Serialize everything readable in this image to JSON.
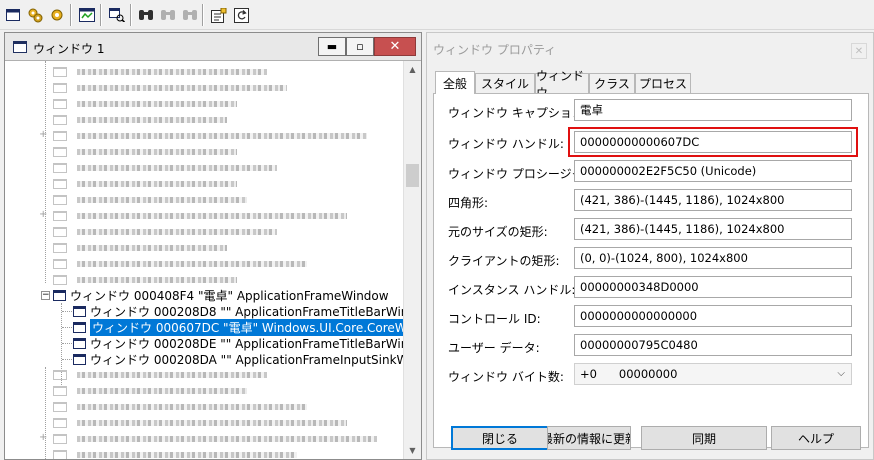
{
  "toolbar": {
    "buttons": [
      "window-list-icon",
      "processes-icon",
      "threads-icon",
      "log-messages-icon",
      "find-window-icon",
      "binoculars-icon",
      "find-next-icon",
      "find-prev-icon",
      "properties-icon",
      "refresh-icon"
    ]
  },
  "left_window": {
    "title": "ウィンドウ 1",
    "min_glyph": "▬",
    "max_glyph": "▫",
    "close_glyph": "✕"
  },
  "tree": {
    "parent": {
      "text": "ウィンドウ 000408F4 \"電卓\" ApplicationFrameWindow",
      "expander": "−"
    },
    "children": [
      {
        "text": "ウィンドウ 000208D8 \"\" ApplicationFrameTitleBarWindow",
        "selected": false
      },
      {
        "text": "ウィンドウ 000607DC \"電卓\" Windows.UI.Core.CoreWindow",
        "selected": true
      },
      {
        "text": "ウィンドウ 000208DE \"\" ApplicationFrameTitleBarWindow",
        "selected": false
      },
      {
        "text": "ウィンドウ 000208DA \"\" ApplicationFrameInputSinkWindow",
        "selected": false
      }
    ]
  },
  "scrollbar": {
    "up": "▲",
    "down": "▼"
  },
  "properties": {
    "title": "ウィンドウ プロパティ",
    "close_glyph": "✕",
    "tabs": [
      "全般",
      "スタイル",
      "ウィンドウ",
      "クラス",
      "プロセス"
    ],
    "active_tab": 0,
    "fields": [
      {
        "label": "ウィンドウ キャプション:",
        "value": "電卓"
      },
      {
        "label": "ウィンドウ ハンドル:",
        "value": "00000000000607DC"
      },
      {
        "label": "ウィンドウ プロシージャ:",
        "value": "000000002E2F5C50 (Unicode)"
      },
      {
        "label": "四角形:",
        "value": "(421, 386)-(1445, 1186), 1024x800"
      },
      {
        "label": "元のサイズの矩形:",
        "value": "(421, 386)-(1445, 1186), 1024x800"
      },
      {
        "label": "クライアントの矩形:",
        "value": "(0, 0)-(1024, 800), 1024x800"
      },
      {
        "label": "インスタンス ハンドル:",
        "value": "00000000348D0000"
      },
      {
        "label": "コントロール ID:",
        "value": "0000000000000000"
      },
      {
        "label": "ユーザー データ:",
        "value": "00000000795C0480"
      },
      {
        "label": "ウィンドウ バイト数:",
        "value": "+0      00000000"
      }
    ],
    "select_caret": "⌵",
    "buttons": {
      "close": "閉じる",
      "refresh": "最新の情報に更新",
      "sync": "同期",
      "help": "ヘルプ"
    }
  },
  "colors": {
    "selection": "#0078d7",
    "highlight_box": "#e01010",
    "close_button": "#c75050"
  }
}
